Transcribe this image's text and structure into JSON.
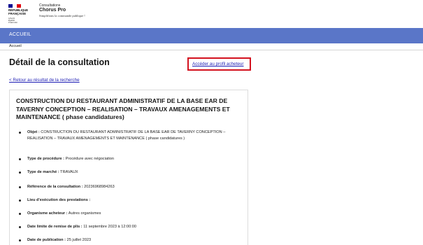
{
  "header": {
    "logo": {
      "lines": [
        "RÉPUBLIQUE",
        "FRANÇAISE"
      ],
      "motto": [
        "Liberté",
        "Égalité",
        "Fraternité"
      ],
      "flag_colors": [
        "#000091",
        "#ffffff",
        "#e1000f"
      ]
    },
    "brand": {
      "small": "Consultations",
      "name": "Chorus Pro",
      "tagline": "Simplifions la commande publique !"
    }
  },
  "nav": {
    "item": "ACCUEIL",
    "color": "#5a76c8"
  },
  "breadcrumb": "Accueil",
  "page": {
    "title": "Détail de la consultation",
    "profile_link": "Accéder au profil acheteur",
    "back_link": "< Retour au résultat de la recherche"
  },
  "consultation": {
    "title": "CONSTRUCTION DU RESTAURANT ADMINISTRATIF DE LA BASE EAR DE TAVERNY CONCEPTION – REALISATION – TRAVAUX AMENAGEMENTS ET MAINTENANCE ( phase candidatures)",
    "details": [
      {
        "label": "Objet :",
        "value": "CONSTRUCTION DU RESTAURANT ADMINISTRATIF DE LA BASE EAR DE TAVERNY CONCEPTION – REALISATION – TRAVAUX AMENAGEMENTS ET MAINTENANCE ( phase candidatures )"
      },
      {
        "label": "Type de procédure :",
        "value": "Procédure avec négociation"
      },
      {
        "label": "Type de marché :",
        "value": "TRAVAUX"
      },
      {
        "label": "Référence de la consultation :",
        "value": "20236968984263"
      },
      {
        "label": "Lieu d'exécution des prestations :",
        "value": ""
      },
      {
        "label": "Organisme acheteur :",
        "value": "Autres organismes"
      },
      {
        "label": "Date limite de remise de plis :",
        "value": "11 septembre 2023 à 12:00:00"
      },
      {
        "label": "Date de publication :",
        "value": "25 juillet 2023"
      }
    ]
  }
}
